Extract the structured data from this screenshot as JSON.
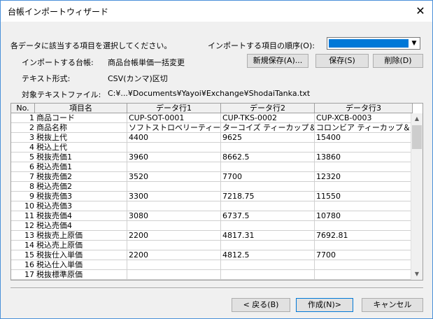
{
  "window": {
    "title": "台帳インポートウィザード"
  },
  "labels": {
    "instruction": "各データに該当する項目を選択してください。",
    "order_label": "インポートする項目の順序(O):",
    "ledger_label": "インポートする台帳:",
    "ledger_value": "商品台帳単価一括変更",
    "format_label": "テキスト形式:",
    "format_value": "CSV(カンマ)区切",
    "file_label": "対象テキストファイル:",
    "file_value": "C:¥...¥Documents¥Yayoi¥Exchange¥ShodaiTanka.txt"
  },
  "buttons": {
    "new_save": "新規保存(A)...",
    "save": "保存(S)",
    "delete": "削除(D)",
    "back": "< 戻る(B)",
    "create": "作成(N)>",
    "cancel": "キャンセル"
  },
  "order_combo": {
    "selected": ""
  },
  "table": {
    "headers": [
      "No.",
      "項目名",
      "データ行1",
      "データ行2",
      "データ行3"
    ],
    "rows": [
      [
        "1",
        "商品コード",
        "CUP-SOT-0001",
        "CUP-TKS-0002",
        "CUP-XCB-0003"
      ],
      [
        "2",
        "商品名称",
        "ソフトストロベリーティーカッ...",
        "ターコイズ ティーカップ＆ソ...",
        "コロンビア ティーカップ＆ソー..."
      ],
      [
        "3",
        "税抜上代",
        "4400",
        "9625",
        "15400"
      ],
      [
        "4",
        "税込上代",
        "",
        "",
        ""
      ],
      [
        "5",
        "税抜売価1",
        "3960",
        "8662.5",
        "13860"
      ],
      [
        "6",
        "税込売価1",
        "",
        "",
        ""
      ],
      [
        "7",
        "税抜売価2",
        "3520",
        "7700",
        "12320"
      ],
      [
        "8",
        "税込売価2",
        "",
        "",
        ""
      ],
      [
        "9",
        "税抜売価3",
        "3300",
        "7218.75",
        "11550"
      ],
      [
        "10",
        "税込売価3",
        "",
        "",
        ""
      ],
      [
        "11",
        "税抜売価4",
        "3080",
        "6737.5",
        "10780"
      ],
      [
        "12",
        "税込売価4",
        "",
        "",
        ""
      ],
      [
        "13",
        "税抜売上原価",
        "2200",
        "4817.31",
        "7692.81"
      ],
      [
        "14",
        "税込売上原価",
        "",
        "",
        ""
      ],
      [
        "15",
        "税抜仕入単価",
        "2200",
        "4812.5",
        "7700"
      ],
      [
        "16",
        "税込仕入単価",
        "",
        "",
        ""
      ],
      [
        "17",
        "税抜標準原価",
        "",
        "",
        ""
      ]
    ]
  },
  "icons": {
    "close": "close-icon",
    "dropdown": "chevron-down-icon",
    "scroll_up": "scroll-up-icon",
    "scroll_down": "scroll-down-icon"
  }
}
